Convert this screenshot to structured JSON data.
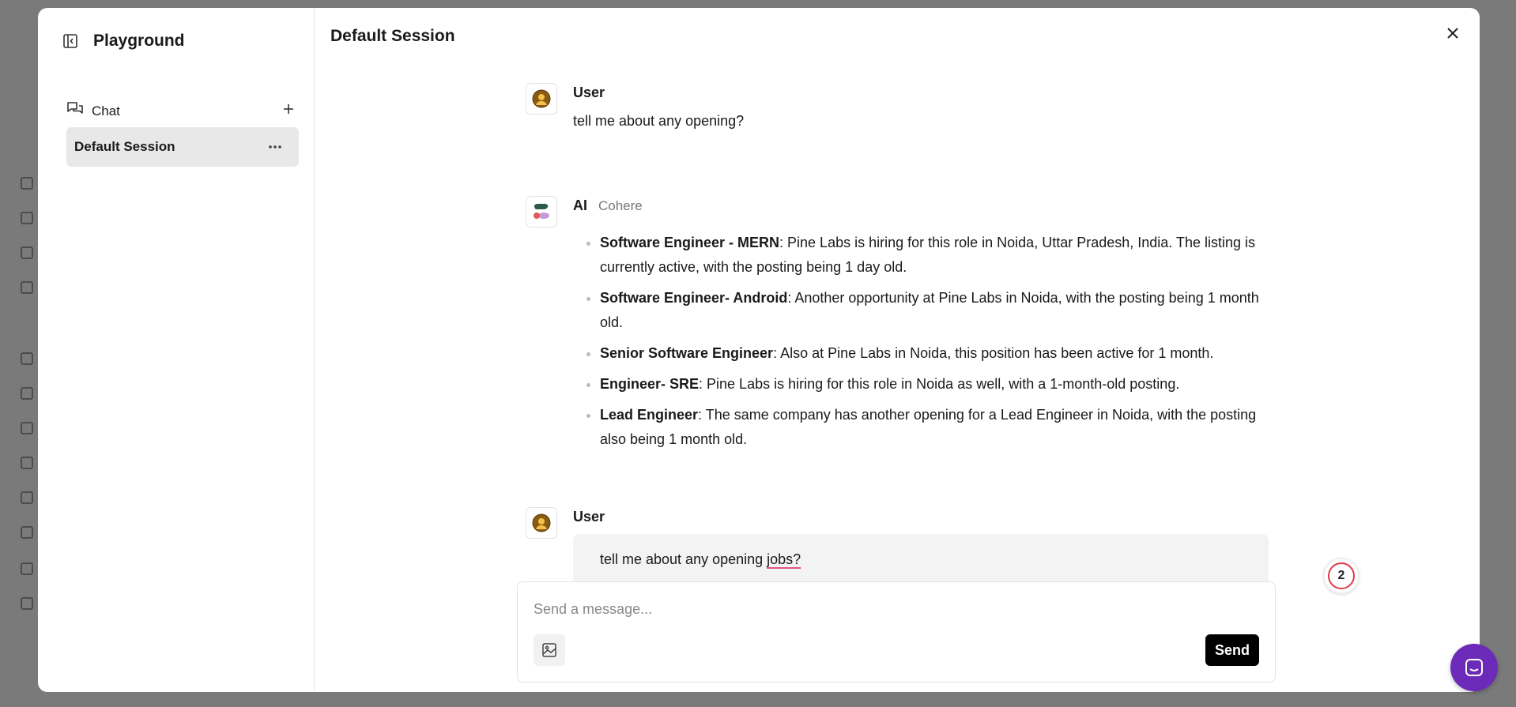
{
  "sidebar": {
    "title": "Playground",
    "section_label": "Chat",
    "sessions": [
      {
        "label": "Default Session",
        "selected": true
      }
    ]
  },
  "main": {
    "title": "Default Session"
  },
  "messages": [
    {
      "sender": "User",
      "text": "tell me about any opening?"
    },
    {
      "sender": "AI",
      "model": "Cohere",
      "items": [
        {
          "title": "Software Engineer - MERN",
          "text": ": Pine Labs is hiring for this role in Noida, Uttar Pradesh, India. The listing is currently active, with the posting being 1 day old."
        },
        {
          "title": "Software Engineer- Android",
          "text": ": Another opportunity at Pine Labs in Noida, with the posting being 1 month old."
        },
        {
          "title": "Senior Software Engineer",
          "text": ": Also at Pine Labs in Noida, this position has been active for 1 month."
        },
        {
          "title": "Engineer- SRE",
          "text": ": Pine Labs is hiring for this role in Noida as well, with a 1-month-old posting."
        },
        {
          "title": "Lead Engineer",
          "text": ": The same company has another opening for a Lead Engineer in Noida, with the posting also being 1 month old."
        }
      ]
    },
    {
      "sender": "User",
      "text_before": "tell me about any opening ",
      "text_flagged": "jobs?"
    }
  ],
  "badge": {
    "count": "2"
  },
  "composer": {
    "placeholder": "Send a message...",
    "value": "",
    "send_label": "Send"
  },
  "colors": {
    "accent_send": "#000000",
    "help_fab": "#6b2ab8",
    "badge_ring": "#e03b4a",
    "spell_underline": "#e0567a"
  },
  "icons": [
    "sidebar-collapse-icon",
    "chat-icon",
    "plus-icon",
    "more-horizontal-icon",
    "close-icon",
    "user-avatar-icon",
    "cohere-logo-icon",
    "image-upload-icon",
    "chat-bubble-icon"
  ]
}
